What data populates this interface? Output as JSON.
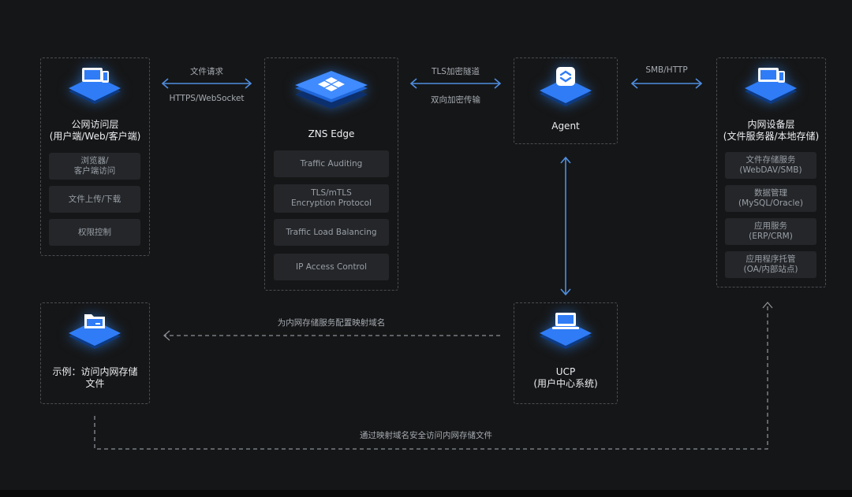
{
  "public_layer": {
    "title_line1": "公网访问层",
    "title_line2": "(用户端/Web/客户端)",
    "items": [
      {
        "line1": "浏览器/",
        "line2": "客户端访问"
      },
      {
        "line1": "文件上传/下载",
        "line2": ""
      },
      {
        "line1": "权限控制",
        "line2": ""
      }
    ]
  },
  "zns_edge": {
    "title": "ZNS Edge",
    "items": [
      {
        "line1": "Traffic Auditing",
        "line2": ""
      },
      {
        "line1": "TLS/mTLS",
        "line2": "Encryption Protocol"
      },
      {
        "line1": "Traffic Load Balancing",
        "line2": ""
      },
      {
        "line1": "IP Access Control",
        "line2": ""
      }
    ]
  },
  "agent": {
    "title": "Agent"
  },
  "intranet_layer": {
    "title_line1": "内网设备层",
    "title_line2": "(文件服务器/本地存储)",
    "items": [
      {
        "line1": "文件存储服务",
        "line2": "(WebDAV/SMB)"
      },
      {
        "line1": "数据管理",
        "line2": "(MySQL/Oracle)"
      },
      {
        "line1": "应用服务",
        "line2": "(ERP/CRM)"
      },
      {
        "line1": "应用程序托管",
        "line2": "(OA/内部站点)"
      }
    ]
  },
  "example": {
    "title_line1": "示例：访问内网存储",
    "title_line2": "文件"
  },
  "ucp": {
    "title_line1": "UCP",
    "title_line2": "(用户中心系统)"
  },
  "connections": {
    "public_to_edge_top": "文件请求",
    "public_to_edge_bottom": "HTTPS/WebSocket",
    "edge_to_agent_top": "TLS加密隧道",
    "edge_to_agent_bottom": "双向加密传输",
    "agent_to_intranet_top": "SMB/HTTP",
    "ucp_to_example": "为内网存储服务配置映射域名",
    "example_to_intranet": "通过映射域名安全访问内网存储文件"
  },
  "colors": {
    "background": "#151617",
    "panel_border": "#4a4d52",
    "chip_bg": "#242629",
    "arrow_blue": "#4f8ee0",
    "dashed_gray": "#8b8f95",
    "icon_blue": "#2f7cf6"
  }
}
